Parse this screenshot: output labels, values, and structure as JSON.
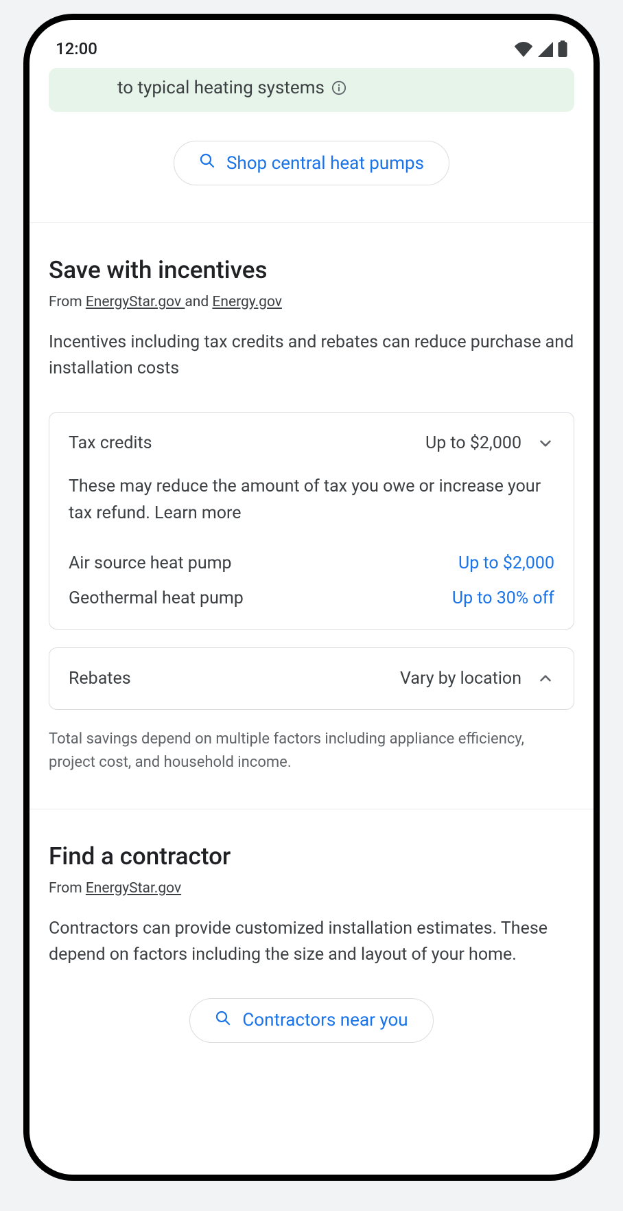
{
  "statusBar": {
    "time": "12:00"
  },
  "banner": {
    "text": "to typical heating systems"
  },
  "shopButton": {
    "label": "Shop central heat pumps"
  },
  "incentives": {
    "title": "Save with incentives",
    "sourcePrefix": "From ",
    "source1": "EnergyStar.gov ",
    "sourceAnd": "and ",
    "source2": "Energy.gov",
    "description": "Incentives including tax credits and rebates can reduce purchase and installation costs",
    "taxCredits": {
      "label": "Tax credits",
      "value": "Up to $2,000",
      "bodyText": "These may reduce the amount of tax you owe or increase your tax refund. Learn more",
      "items": [
        {
          "label": "Air source heat pump",
          "value": "Up to $2,000"
        },
        {
          "label": "Geothermal heat pump",
          "value": "Up to 30% off"
        }
      ]
    },
    "rebates": {
      "label": "Rebates",
      "value": "Vary by location"
    },
    "disclaimer": "Total savings depend on multiple factors including appliance efficiency, project cost, and household income."
  },
  "contractor": {
    "title": "Find a contractor",
    "sourcePrefix": "From ",
    "source1": "EnergyStar.gov",
    "description": "Contractors can provide customized installation estimates. These depend on factors including the size and layout of your home.",
    "buttonLabel": "Contractors near you"
  }
}
